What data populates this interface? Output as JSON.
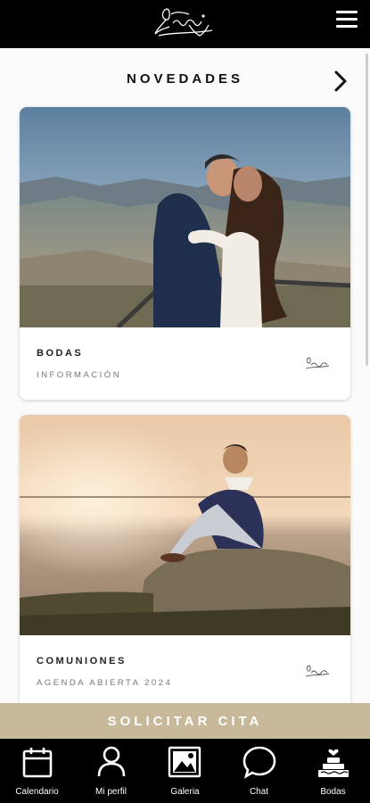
{
  "header": {
    "logo_text": "Joseva Digital",
    "menu_icon": "hamburger-menu-icon"
  },
  "section": {
    "title": "NOVEDADES",
    "next_icon": "chevron-right-icon"
  },
  "cards": [
    {
      "title": "BODAS",
      "subtitle": "INFORMACIÓN",
      "image": "couple-kissing-photo"
    },
    {
      "title": "COMUNIONES",
      "subtitle": "AGENDA ABIERTA 2024",
      "image": "boy-sitting-on-rock-photo"
    }
  ],
  "cta": {
    "label": "SOLICITAR CITA"
  },
  "nav": [
    {
      "label": "Calendario",
      "icon": "calendar-icon"
    },
    {
      "label": "Mi perfil",
      "icon": "profile-icon"
    },
    {
      "label": "Galeria",
      "icon": "gallery-icon"
    },
    {
      "label": "Chat",
      "icon": "chat-icon"
    },
    {
      "label": "Bodas",
      "icon": "wedding-cake-icon"
    }
  ],
  "colors": {
    "topbar": "#000000",
    "cta": "#c8b89a",
    "nav": "#000000"
  }
}
